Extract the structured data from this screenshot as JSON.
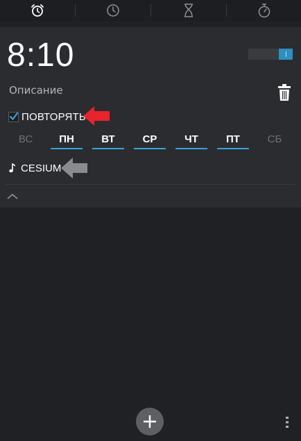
{
  "tabs": [
    {
      "name": "alarm",
      "icon": "alarm-clock-icon",
      "selected": true
    },
    {
      "name": "clock",
      "icon": "clock-icon",
      "selected": false
    },
    {
      "name": "timer",
      "icon": "hourglass-icon",
      "selected": false
    },
    {
      "name": "stopwatch",
      "icon": "stopwatch-icon",
      "selected": false
    }
  ],
  "alarm": {
    "time": "8:10",
    "enabled": true,
    "description": "Описание",
    "repeat_label": "ПОВТОРЯТЬ",
    "repeat_checked": true,
    "days": [
      {
        "label": "ВС",
        "active": false
      },
      {
        "label": "ПН",
        "active": true
      },
      {
        "label": "ВТ",
        "active": true
      },
      {
        "label": "СР",
        "active": true
      },
      {
        "label": "ЧТ",
        "active": true
      },
      {
        "label": "ПТ",
        "active": true
      },
      {
        "label": "СБ",
        "active": false
      }
    ],
    "ringtone": "CESIUM"
  },
  "colors": {
    "accent": "#33a6d6",
    "background": "#202124",
    "card": "#2b2c30",
    "arrow_red": "#e8232a",
    "arrow_gray": "#8a8b8e"
  },
  "icons": {
    "delete": "trash-icon",
    "ringtone": "music-note-icon",
    "collapse": "chevron-up-icon",
    "add": "plus-icon",
    "menu": "overflow-menu-icon"
  }
}
